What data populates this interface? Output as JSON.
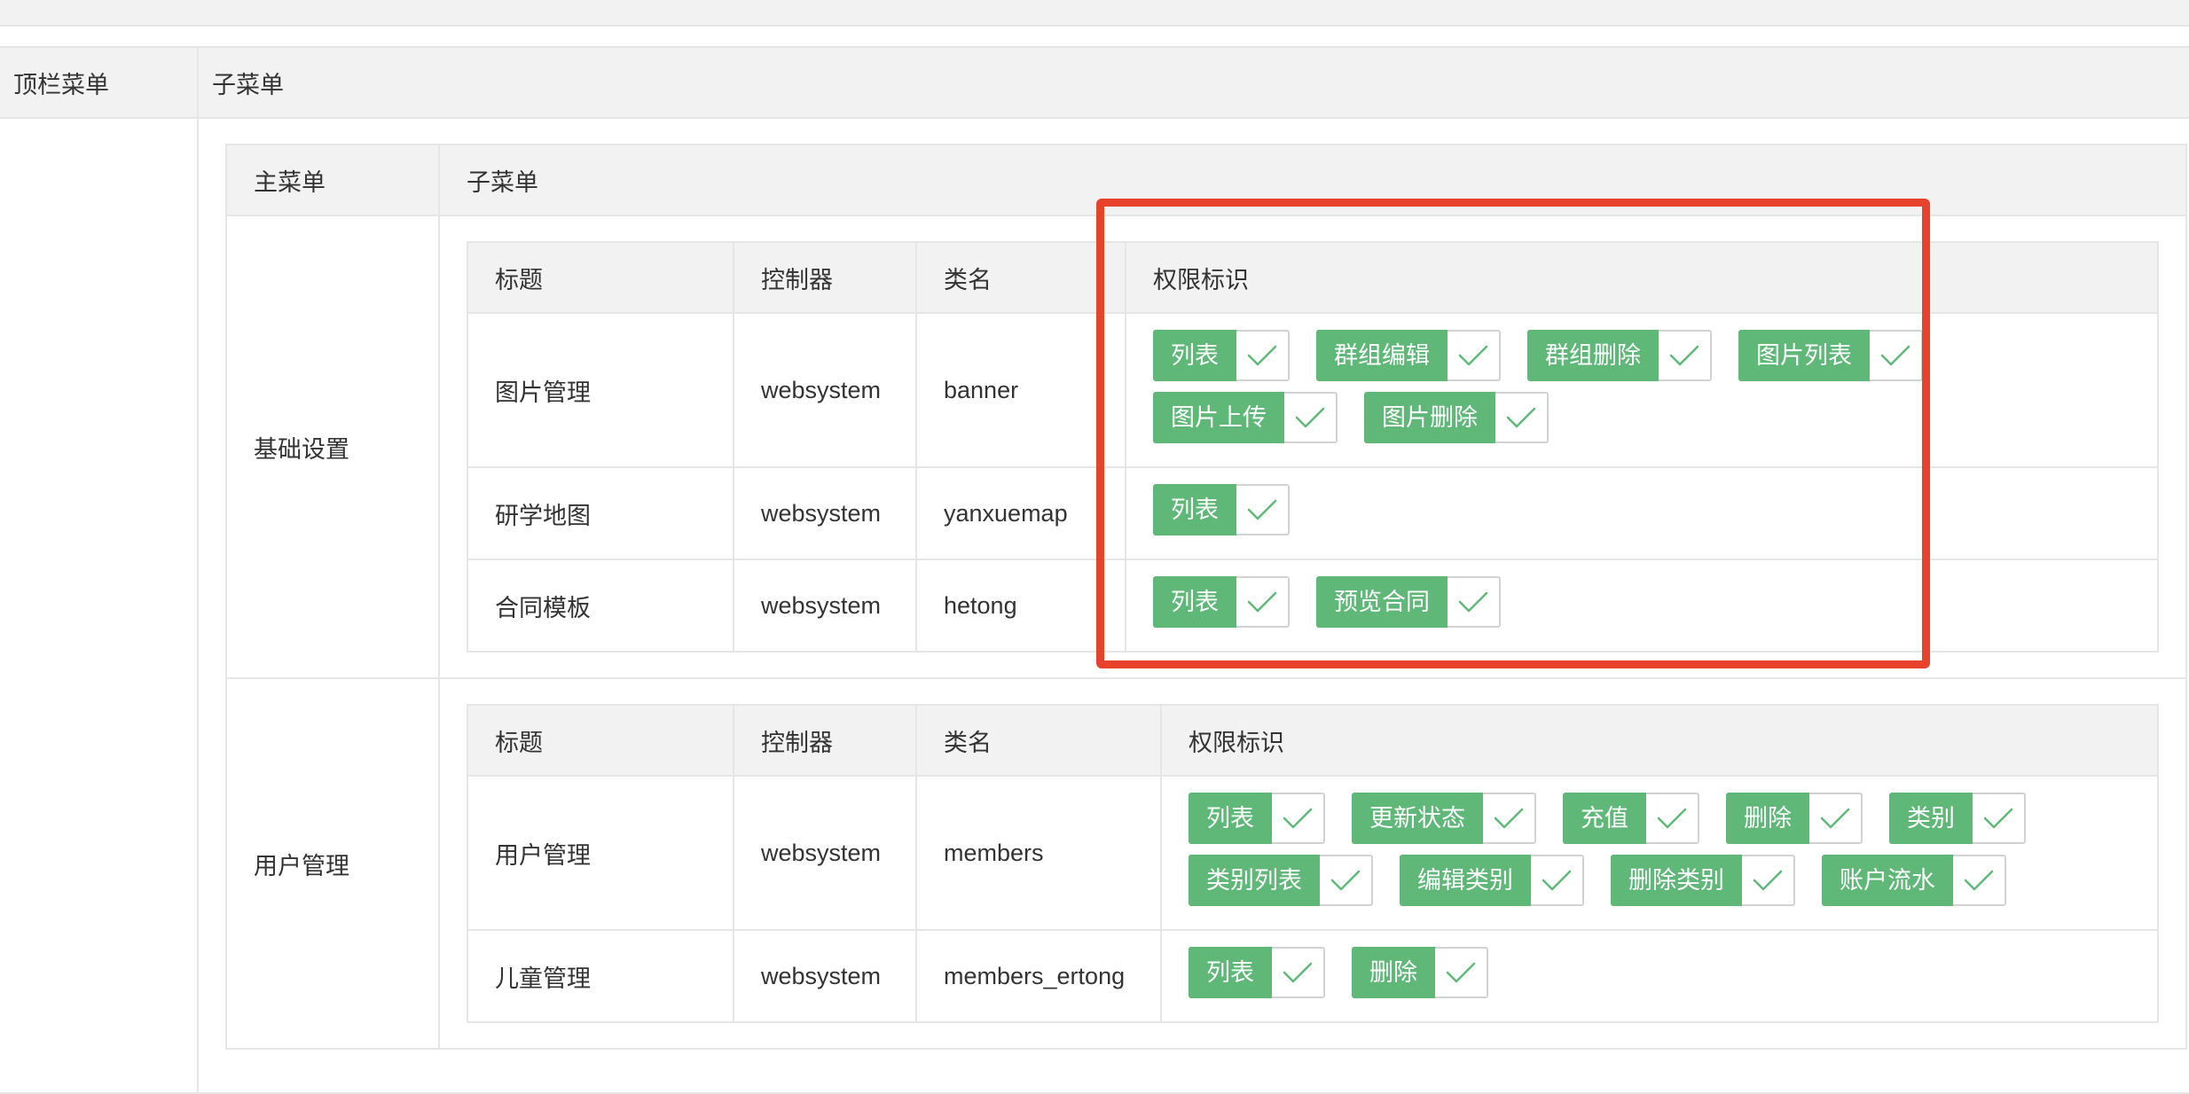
{
  "outer": {
    "col_top_menu": "顶栏菜单",
    "col_sub_menu": "子菜单"
  },
  "mid": {
    "col_main_menu": "主菜单",
    "col_sub_menu": "子菜单"
  },
  "inner_headers": {
    "title": "标题",
    "controller": "控制器",
    "class_name": "类名",
    "permission": "权限标识"
  },
  "groups": [
    {
      "name": "基础设置",
      "rows": [
        {
          "title": "图片管理",
          "controller": "websystem",
          "class_name": "banner",
          "perms": [
            "列表",
            "群组编辑",
            "群组删除",
            "图片列表",
            "图片上传",
            "图片删除"
          ]
        },
        {
          "title": "研学地图",
          "controller": "websystem",
          "class_name": "yanxuemap",
          "perms": [
            "列表"
          ]
        },
        {
          "title": "合同模板",
          "controller": "websystem",
          "class_name": "hetong",
          "perms": [
            "列表",
            "预览合同"
          ]
        }
      ]
    },
    {
      "name": "用户管理",
      "rows": [
        {
          "title": "用户管理",
          "controller": "websystem",
          "class_name": "members",
          "perms": [
            "列表",
            "更新状态",
            "充值",
            "删除",
            "类别",
            "类别列表",
            "编辑类别",
            "删除类别",
            "账户流水"
          ]
        },
        {
          "title": "儿童管理",
          "controller": "websystem",
          "class_name": "members_ertong",
          "perms": [
            "列表",
            "删除"
          ]
        }
      ]
    }
  ],
  "colors": {
    "perm_green": "#5fb878",
    "check_green": "#5fb878",
    "highlight_red": "#e8412c"
  },
  "icons": {
    "check": "check-icon"
  }
}
